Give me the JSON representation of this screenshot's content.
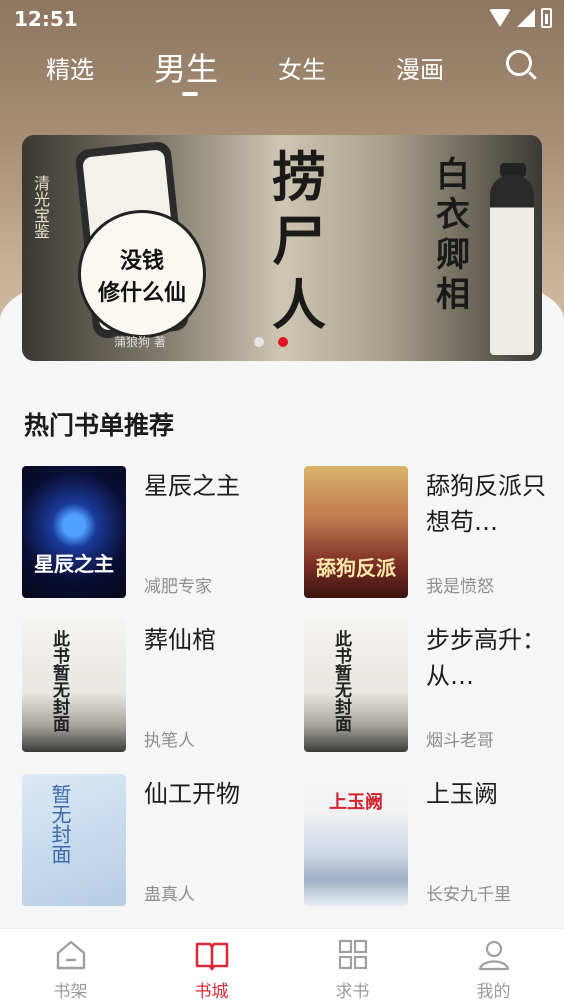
{
  "status_bar": {
    "time": "12:51"
  },
  "tabs": [
    {
      "label": "精选"
    },
    {
      "label": "男生",
      "active": true
    },
    {
      "label": "女生"
    },
    {
      "label": "漫画"
    }
  ],
  "banner": {
    "side_text": "清光宝鉴",
    "slogan_line1": "没钱",
    "slogan_line2": "修什么仙",
    "author": "蒲狼狗 著",
    "title_left": "捞尸人",
    "title_right": "白衣卿相",
    "slide_count": 2,
    "active_slide": 2
  },
  "section": {
    "title": "热门书单推荐"
  },
  "books": [
    {
      "title": "星辰之主",
      "author": "减肥专家",
      "cover_text": "星辰之主"
    },
    {
      "title": "舔狗反派只想苟…",
      "author": "我是愤怒",
      "cover_text": "舔狗反派"
    },
    {
      "title": "葬仙棺",
      "author": "执笔人",
      "cover_text": "此书暂无封面"
    },
    {
      "title": "步步高升：从…",
      "author": "烟斗老哥",
      "cover_text": "此书暂无封面"
    },
    {
      "title": "仙工开物",
      "author": "蛊真人",
      "cover_text": "暂无封面"
    },
    {
      "title": "上玉阙",
      "author": "长安九千里",
      "cover_text": "上玉阙"
    }
  ],
  "bottom_nav": [
    {
      "label": "书架",
      "icon": "bookshelf-icon"
    },
    {
      "label": "书城",
      "icon": "book-open-icon",
      "active": true
    },
    {
      "label": "求书",
      "icon": "grid-icon"
    },
    {
      "label": "我的",
      "icon": "user-icon"
    }
  ],
  "colors": {
    "accent": "#d92b37",
    "header": "#9c8369"
  }
}
